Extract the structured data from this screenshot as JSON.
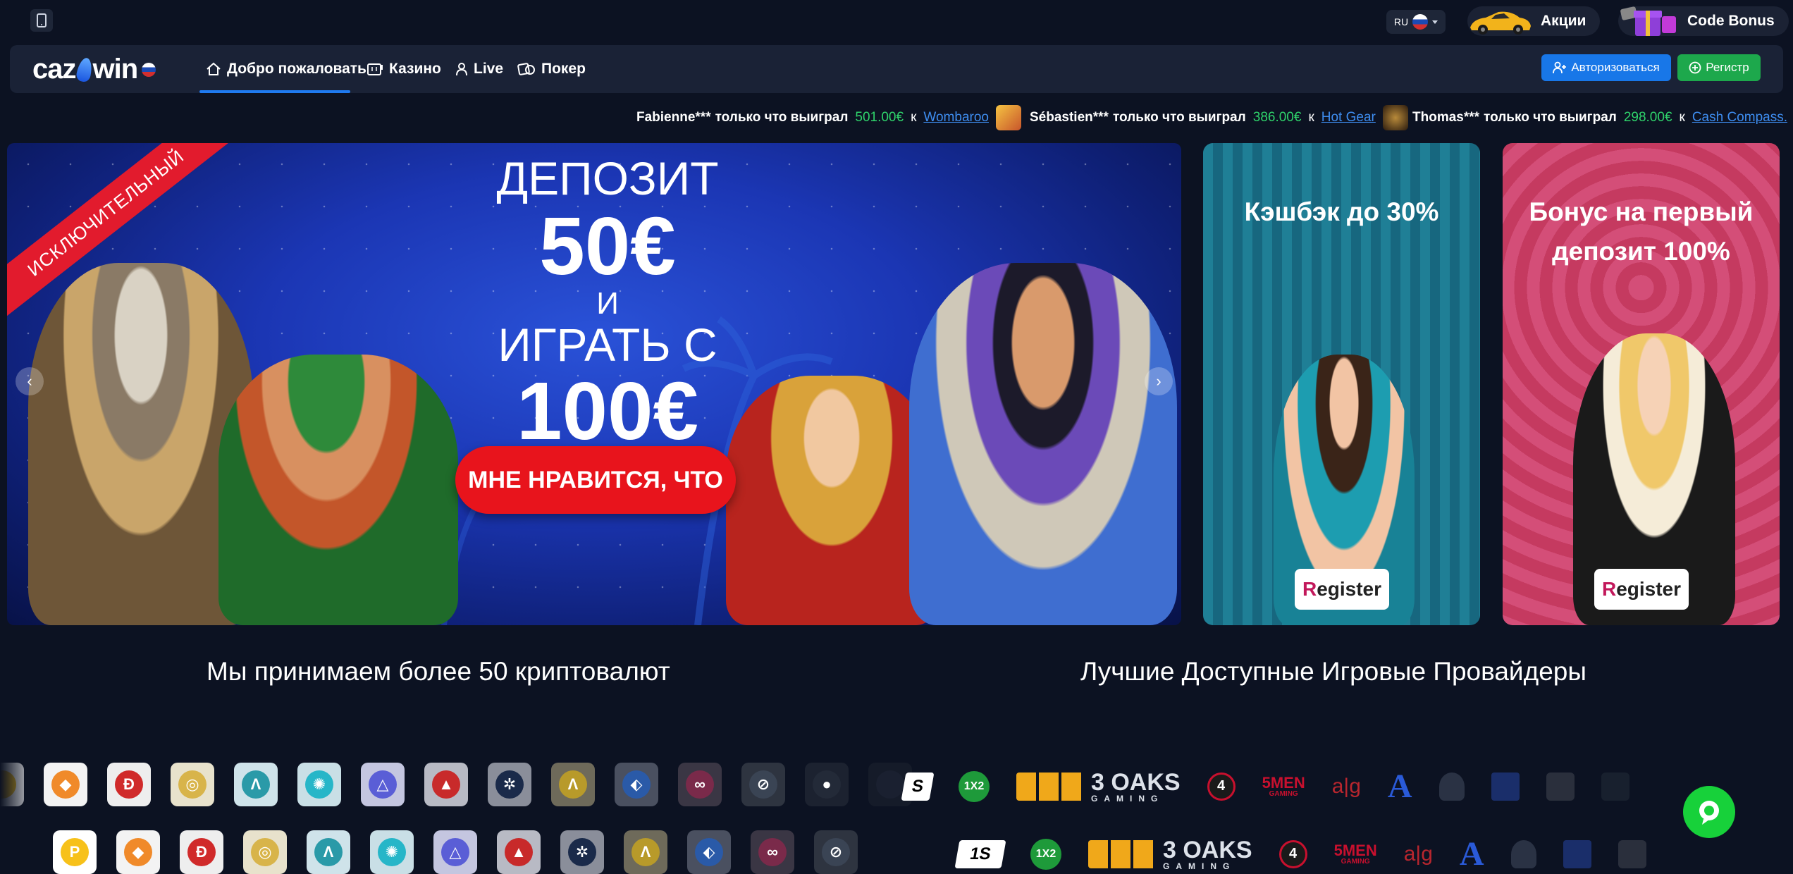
{
  "topbar": {
    "language_code": "RU",
    "promotions_label": "Акции",
    "code_bonus_label": "Code Bonus"
  },
  "nav": {
    "logo_text_left": "caz",
    "logo_text_right": "win",
    "items": [
      {
        "label": "Добро пожаловать",
        "icon": "home-icon"
      },
      {
        "label": "Казино",
        "icon": "slot-machine-icon"
      },
      {
        "label": "Live",
        "icon": "person-icon"
      },
      {
        "label": "Покер",
        "icon": "poker-chip-icon"
      }
    ],
    "login_label": "Авторизоваться",
    "register_label": "Регистр"
  },
  "ticker": [
    {
      "user": "Fabienne***",
      "text": "только что выиграл",
      "amount": "501.00€",
      "to": "к",
      "game": "Wombaroo"
    },
    {
      "user": "Sébastien***",
      "text": "только что выиграл",
      "amount": "386.00€",
      "to": "к",
      "game": "Hot Gear"
    },
    {
      "user": "Thomas***",
      "text": "только что выиграл",
      "amount": "298.00€",
      "to": "к",
      "game": "Cash Compass."
    }
  ],
  "banner": {
    "ribbon": "ИСКЛЮЧИТЕЛЬНЫЙ",
    "line1": "ДЕПОЗИТ",
    "line2": "50€",
    "line3": "И",
    "line4": "ИГРАТЬ С",
    "line5": "100€",
    "cta": "МНЕ НРАВИТСЯ, ЧТО"
  },
  "cards": [
    {
      "title": "Кэшбэк до 30%",
      "button_first": "R",
      "button_rest": "egister"
    },
    {
      "title": "Бонус на первый депозит 100%",
      "button_first": "R",
      "button_rest": "egister"
    }
  ],
  "sections": {
    "crypto_title": "Мы принимаем более 50 криптовалют",
    "providers_title": "Лучшие Доступные Игровые Провайдеры"
  },
  "providers": {
    "oaks_main": "3 OAKS",
    "oaks_sub": "GAMING",
    "five_men": "5MEN",
    "five_men_sub": "GAMING",
    "ag": "a|g",
    "a_letter": "A",
    "one_x_two": "1X2",
    "four": "4"
  },
  "colors": {
    "background": "#0c1222",
    "navbar": "#1a2236",
    "accent_blue": "#1877e8",
    "accent_green": "#1da84c",
    "win_amount": "#2fd36b",
    "cta_red": "#e8141c",
    "chat_green": "#17d13a"
  }
}
